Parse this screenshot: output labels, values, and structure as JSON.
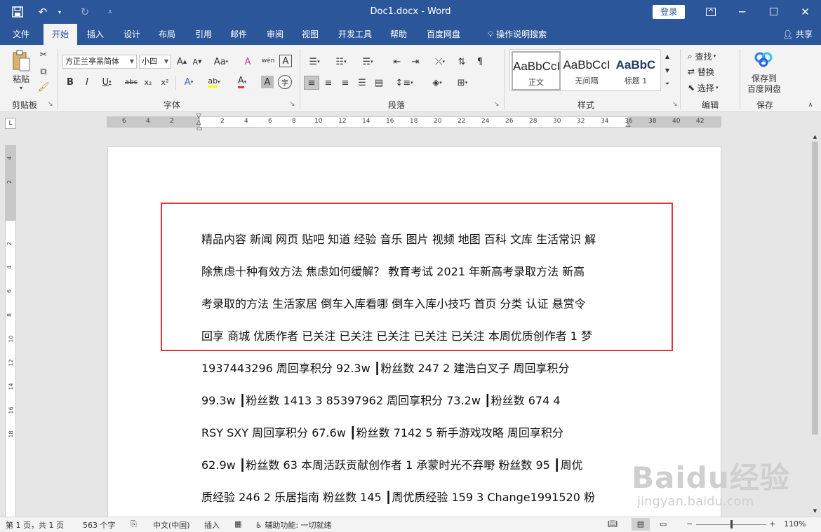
{
  "title_bar": {
    "document_title": "Doc1.docx  -  Word",
    "login_label": "登录",
    "quick_access": [
      "save-icon",
      "undo-icon",
      "redo-icon",
      "customize-icon"
    ]
  },
  "tabs": [
    "文件",
    "开始",
    "插入",
    "设计",
    "布局",
    "引用",
    "邮件",
    "审阅",
    "视图",
    "开发工具",
    "帮助",
    "百度网盘"
  ],
  "active_tab": "开始",
  "tell_me": "操作说明搜索",
  "share_label": "共享",
  "ribbon": {
    "clipboard": {
      "paste_label": "粘贴",
      "group_label": "剪贴板"
    },
    "font": {
      "font_name": "方正兰亭黑简体",
      "font_size": "小四",
      "group_label": "字体",
      "grow": "A",
      "shrink": "A",
      "case": "Aa",
      "bold": "B",
      "italic": "I",
      "underline": "U",
      "strike": "abc",
      "subscript": "x₂",
      "superscript": "x²",
      "clear": "A",
      "phonetic": "wén",
      "border_char": "A",
      "circle": "字",
      "text_effect": "A",
      "highlight": "ab",
      "font_color": "A",
      "shading": "A"
    },
    "paragraph": {
      "group_label": "段落"
    },
    "styles": {
      "group_label": "样式",
      "items": [
        {
          "preview": "AaBbCcI",
          "name": "正文"
        },
        {
          "preview": "AaBbCcI",
          "name": "无间隔"
        },
        {
          "preview": "AaBbC",
          "name": "标题 1"
        }
      ]
    },
    "editing": {
      "find": "查找",
      "replace": "替换",
      "select": "选择",
      "group_label": "编辑"
    },
    "save": {
      "label_line1": "保存到",
      "label_line2": "百度网盘",
      "group_label": "保存"
    }
  },
  "ruler": {
    "corner": "L",
    "h_labels": [
      "6",
      "4",
      "2",
      "2",
      "4",
      "6",
      "8",
      "10",
      "12",
      "14",
      "16",
      "18",
      "20",
      "22",
      "24",
      "26",
      "28",
      "30",
      "32",
      "34",
      "36",
      "38",
      "40",
      "42"
    ],
    "v_labels": [
      "4",
      "2",
      "2",
      "4",
      "6",
      "8",
      "10",
      "12",
      "14",
      "16",
      "18"
    ]
  },
  "document": {
    "lines": [
      "精品内容 新闻 网页 贴吧 知道 经验 音乐 图片 视频 地图 百科 文库 生活常识 解",
      "除焦虑十种有效方法 焦虑如何缓解？ 教育考试 2021 年新高考录取方法 新高",
      "考录取的方法 生活家居 倒车入库看哪 倒车入库小技巧 首页 分类 认证 悬赏令",
      "回享 商城 优质作者 已关注 已关注 已关注 已关注 已关注 本周优质创作者 1 梦",
      "1937443296 周回享积分 92.3w ┃粉丝数 247 2 建浩白叉子 周回享积分",
      "99.3w ┃粉丝数 1413 3 85397962 周回享积分 73.2w ┃粉丝数 674 4",
      "RSY SXY 周回享积分 67.6w ┃粉丝数 7142 5 新手游戏攻略 周回享积分",
      "62.9w ┃粉丝数 63 本周活跃贡献创作者 1 承蒙时光不弃嘢 粉丝数 95 ┃周优",
      "质经验 246 2 乐居指南 粉丝数 145 ┃周优质经验 159 3 Change1991520 粉"
    ]
  },
  "status_bar": {
    "page": "第 1 页，共 1 页",
    "words": "563 个字",
    "language": "中文(中国)",
    "mode": "插入",
    "accessibility": "辅助功能: 一切就绪",
    "zoom": "110%",
    "zoom_fraction": 0.5
  },
  "watermark": {
    "main": "Baidu经验",
    "sub": "jingyan.baidu.com"
  },
  "colors": {
    "title_bar": "#2b579a",
    "ribbon": "#f3f3f3",
    "highlight_box": "#e0353b"
  }
}
